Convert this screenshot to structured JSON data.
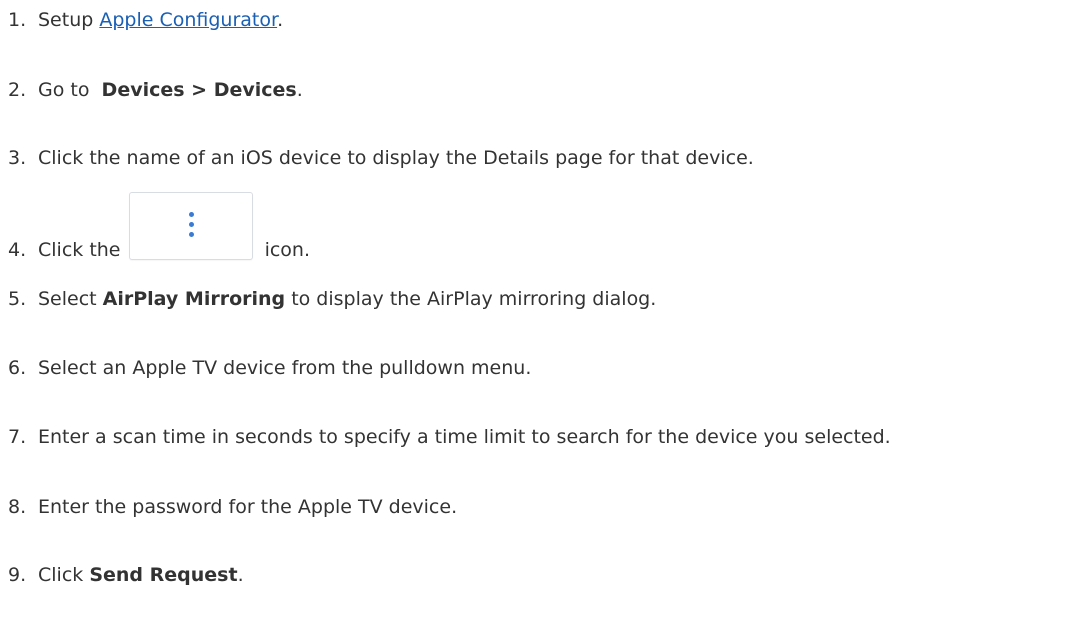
{
  "steps": [
    {
      "num": "1.",
      "text_before": "Setup ",
      "link": "Apple Configurator",
      "text_after": "."
    },
    {
      "num": "2.",
      "text_before": "Go to  ",
      "bold": "Devices > Devices",
      "text_after": "."
    },
    {
      "num": "3.",
      "text": "Click the name of an iOS device to display the Details page for that device."
    },
    {
      "num": "4.",
      "text_before": "Click the ",
      "text_after": " icon.",
      "icon": "kebab-menu-icon"
    },
    {
      "num": "5.",
      "text_before": "Select ",
      "bold": "AirPlay Mirroring",
      "text_after": " to display the AirPlay mirroring dialog."
    },
    {
      "num": "6.",
      "text": "Select an Apple TV device from the pulldown menu."
    },
    {
      "num": "7.",
      "text": "Enter a scan time in seconds to specify a time limit to search for the device you selected."
    },
    {
      "num": "8.",
      "text": "Enter the password for the Apple TV device."
    },
    {
      "num": "9.",
      "text_before": "Click ",
      "bold": "Send Request",
      "text_after": "."
    }
  ],
  "colors": {
    "text": "#333333",
    "link": "#1a5fb4",
    "icon_dots": "#3a7bd5",
    "icon_border": "#d8dde3"
  }
}
